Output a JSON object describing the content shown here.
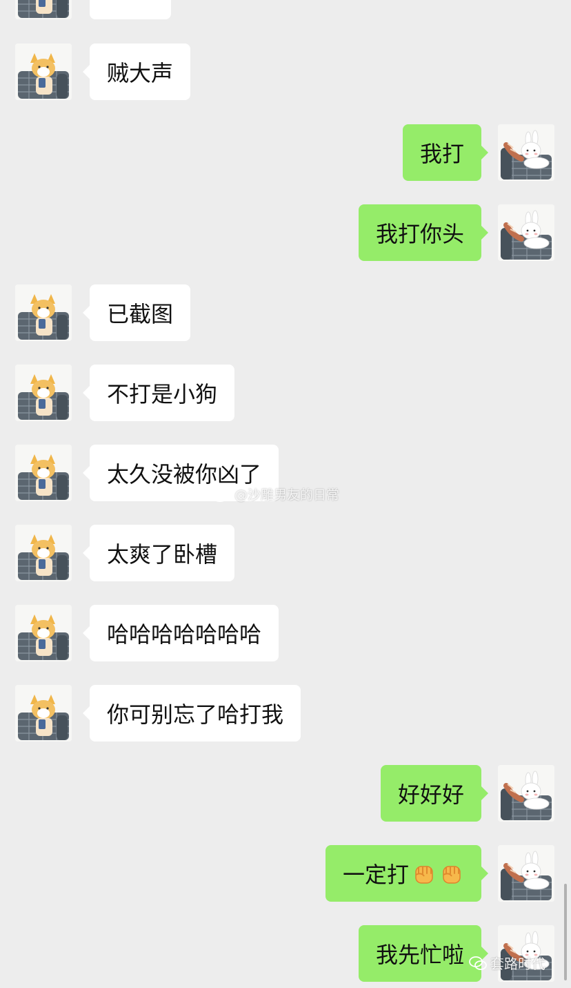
{
  "chat": {
    "messages": [
      {
        "side": "left",
        "text": ""
      },
      {
        "side": "left",
        "text": "贼大声"
      },
      {
        "side": "right",
        "text": "我打"
      },
      {
        "side": "right",
        "text": "我打你头"
      },
      {
        "side": "left",
        "text": "已截图"
      },
      {
        "side": "left",
        "text": "不打是小狗"
      },
      {
        "side": "left",
        "text": "太久没被你凶了"
      },
      {
        "side": "left",
        "text": "太爽了卧槽"
      },
      {
        "side": "left",
        "text": "哈哈哈哈哈哈哈"
      },
      {
        "side": "left",
        "text": "你可别忘了哈打我"
      },
      {
        "side": "right",
        "text": "好好好"
      },
      {
        "side": "right",
        "text": "一定打",
        "emoji": [
          "fist-emoji",
          "fist-emoji"
        ]
      },
      {
        "side": "right",
        "text": "我先忙啦"
      }
    ]
  },
  "watermarks": {
    "weibo": "@沙雕男友的日常",
    "wechat": "套路时代"
  },
  "colors": {
    "background": "#ededed",
    "incoming_bubble": "#ffffff",
    "outgoing_bubble": "#95ec69"
  }
}
